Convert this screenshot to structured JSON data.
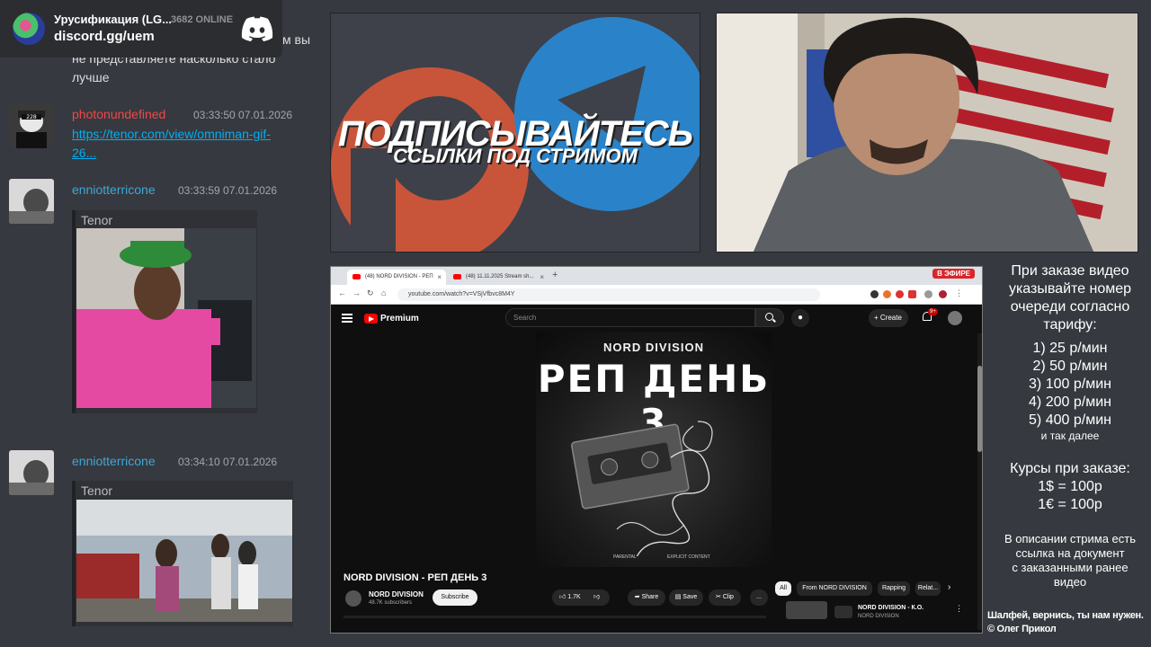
{
  "discord_widget": {
    "server_name": "Урусификация (LG...",
    "online_count": "3682 ONLINE",
    "invite": "discord.gg/uem"
  },
  "chat": {
    "partial_lines": [
      "м вы",
      "не представляете насколько стало",
      "лучше"
    ],
    "messages": [
      {
        "user": "photonundefined",
        "user_color": "#f04747",
        "timestamp": "03:33:50 07.01.2026",
        "link_lines": [
          "https://tenor.com/view/omniman-gif-",
          "26..."
        ]
      },
      {
        "user": "enniotterricone",
        "user_color": "#3fa7d6",
        "timestamp": "03:33:59 07.01.2026",
        "embed_label": "Tenor"
      },
      {
        "user": "enniotterricone",
        "user_color": "#3fa7d6",
        "timestamp": "03:34:10 07.01.2026",
        "embed_label": "Tenor"
      }
    ]
  },
  "promo": {
    "title": "ПОДПИСЫВАЙТЕСЬ",
    "subtitle": "ССЫЛКИ ПОД СТРИМОМ"
  },
  "browser": {
    "tabs": [
      "(48) NORD DIVISION - РЕП",
      "(48) 11.11.2025 Stream sh..."
    ],
    "live_badge": "В ЭФИРЕ",
    "url": "youtube.com/watch?v=VSjVfbvc8M4Y",
    "youtube": {
      "brand": "Premium",
      "search_placeholder": "Search",
      "create_label": "Create",
      "notification_count": "9+",
      "cover_artist": "NORD DIVISION",
      "cover_title": "РЕП ДЕНЬ 3",
      "cover_fine_left": "PARENTAL",
      "cover_fine_right": "EXPLICIT CONTENT",
      "video_title": "NORD DIVISION - РЕП ДЕНЬ 3",
      "channel_name": "NORD DIVISION",
      "channel_subs": "48.7K subscribers",
      "subscribe_label": "Subscribe",
      "likes": "1.7K",
      "share_label": "Share",
      "save_label": "Save",
      "clip_label": "Clip",
      "more_label": "...",
      "chips": [
        "All",
        "From NORD DIVISION",
        "Rapping",
        "Relat..."
      ],
      "recommended_title": "NORD DIVISION - К.О.",
      "recommended_sub": "NORD DIVISION"
    }
  },
  "info_panel": {
    "heading_lines": [
      "При заказе видео",
      "указывайте номер",
      "очереди согласно",
      "тарифу:"
    ],
    "tariffs": [
      "1) 25 р/мин",
      "2) 50 р/мин",
      "3) 100 р/мин",
      "4) 200 р/мин",
      "5) 400 р/мин"
    ],
    "etc": "и так далее",
    "rates_heading": "Курсы при заказе:",
    "rates": [
      "1$ = 100р",
      "1€ = 100р"
    ],
    "note_lines": [
      "В описании стрима есть",
      "ссылка на документ",
      "с заказанными ранее",
      "видео"
    ]
  },
  "credits": [
    "Шалфей, вернись, ты нам нужен.",
    "© Олег Прикол"
  ],
  "colors": {
    "background": "#36393f",
    "discord_blurple": "#5865f2",
    "patreon_orange": "#c8553a",
    "telegram_blue": "#2a83c9",
    "youtube_red": "#ff0000",
    "live_red": "#d8262b"
  }
}
